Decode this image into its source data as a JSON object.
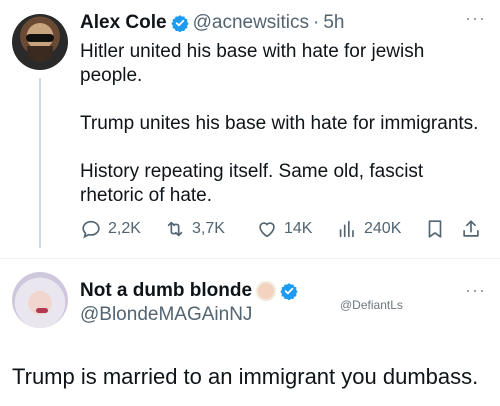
{
  "tweet1": {
    "display_name": "Alex Cole",
    "handle": "@acnewsitics",
    "separator": "·",
    "time": "5h",
    "more": "···",
    "text": {
      "p1": "Hitler united his base with hate for jewish people.",
      "p2": "Trump unites his base with hate for immigrants.",
      "p3": "History repeating itself. Same old, fascist rhetoric of hate."
    },
    "actions": {
      "replies": "2,2K",
      "reposts": "3,7K",
      "likes": "14K",
      "views": "240K"
    },
    "icons": [
      "verified-badge-icon",
      "reply-icon",
      "repost-icon",
      "like-icon",
      "views-icon",
      "bookmark-icon",
      "share-icon"
    ]
  },
  "tweet2": {
    "display_name": "Not a dumb blonde",
    "handle": "@BlondeMAGAinNJ",
    "more": "···",
    "watermark": "@DefiantLs",
    "text": "Trump is married to an immigrant you dumbass."
  },
  "colors": {
    "verified_blue": "#1d9bf0",
    "secondary_text": "#536471",
    "primary_text": "#0f1419"
  }
}
